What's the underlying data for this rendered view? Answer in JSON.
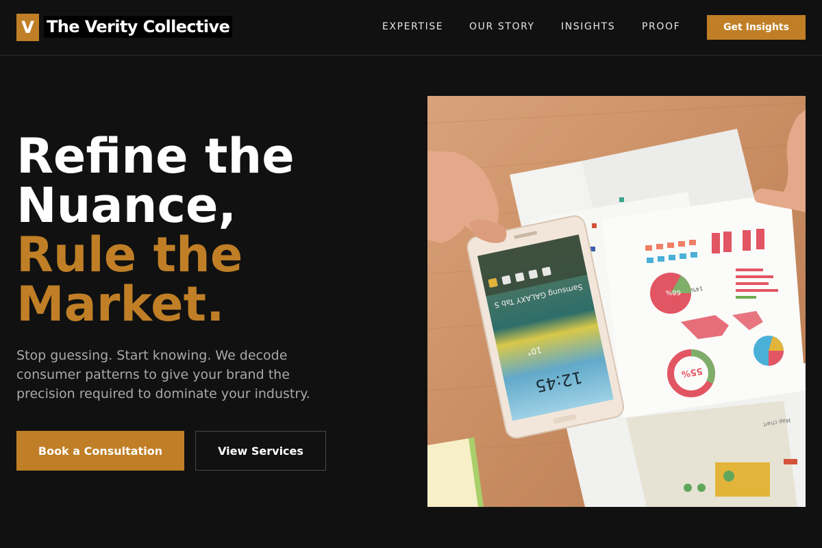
{
  "header": {
    "logo_letter": "V",
    "brand_name": "The Verity Collective",
    "nav": [
      "EXPERTISE",
      "OUR STORY",
      "INSIGHTS",
      "PROOF"
    ],
    "cta_label": "Get Insights"
  },
  "hero": {
    "headline_line1": "Refine the",
    "headline_line2": "Nuance,",
    "headline_line3": "Rule the",
    "headline_line4": "Market.",
    "subtext": "Stop guessing. Start knowing. We decode consumer patterns to give your brand the precision required to dominate your industry.",
    "primary_button": "Book a Consultation",
    "secondary_button": "View Services"
  },
  "image": {
    "tablet_brand": "Samsung GALAXY Tab S",
    "tablet_time": "12:45",
    "tablet_temp": "10°",
    "chart_percent_a": "68%",
    "chart_percent_b": "14%",
    "chart_percent_c": "55%",
    "paper_label": "Map chart"
  },
  "colors": {
    "accent": "#c07f26",
    "background": "#111111",
    "muted_text": "#a9a9a9"
  }
}
